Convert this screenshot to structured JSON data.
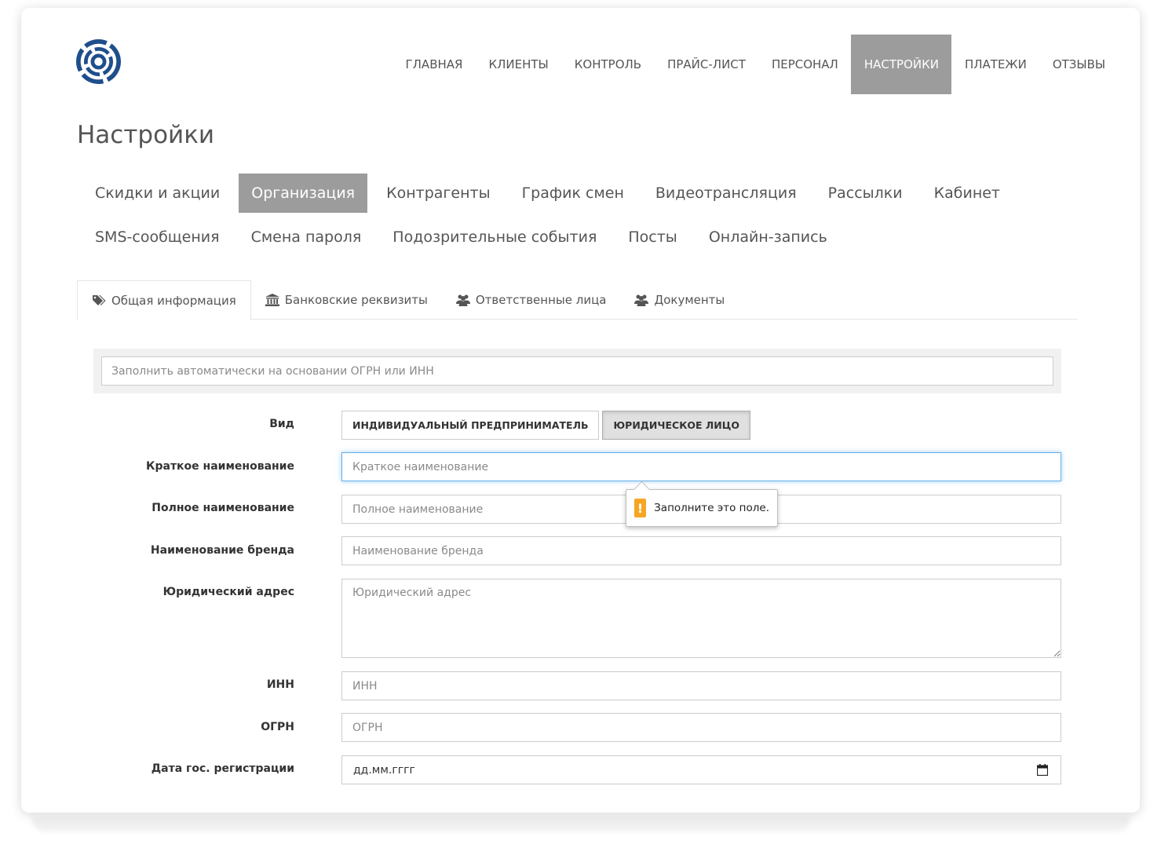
{
  "header": {
    "logo_icon": "target-logo-icon",
    "nav": [
      {
        "label": "ГЛАВНАЯ",
        "active": false
      },
      {
        "label": "КЛИЕНТЫ",
        "active": false
      },
      {
        "label": "КОНТРОЛЬ",
        "active": false
      },
      {
        "label": "ПРАЙС-ЛИСТ",
        "active": false
      },
      {
        "label": "ПЕРСОНАЛ",
        "active": false
      },
      {
        "label": "НАСТРОЙКИ",
        "active": true
      },
      {
        "label": "ПЛАТЕЖИ",
        "active": false
      },
      {
        "label": "ОТЗЫВЫ",
        "active": false
      }
    ]
  },
  "page": {
    "title": "Настройки"
  },
  "settings_tabs": {
    "row1": [
      {
        "label": "Скидки и акции",
        "active": false
      },
      {
        "label": "Организация",
        "active": true
      },
      {
        "label": "Контрагенты",
        "active": false
      },
      {
        "label": "График смен",
        "active": false
      },
      {
        "label": "Видеотрансляция",
        "active": false
      },
      {
        "label": "Рассылки",
        "active": false
      },
      {
        "label": "Кабинет",
        "active": false
      }
    ],
    "row2": [
      {
        "label": "SMS-сообщения",
        "active": false
      },
      {
        "label": "Смена пароля",
        "active": false
      },
      {
        "label": "Подозрительные события",
        "active": false
      },
      {
        "label": "Посты",
        "active": false
      },
      {
        "label": "Онлайн-запись",
        "active": false
      }
    ]
  },
  "subtabs": [
    {
      "label": "Общая информация",
      "icon": "tags-icon",
      "active": true
    },
    {
      "label": "Банковские реквизиты",
      "icon": "bank-icon",
      "active": false
    },
    {
      "label": "Ответственные лица",
      "icon": "users-icon",
      "active": false
    },
    {
      "label": "Документы",
      "icon": "users-icon",
      "active": false
    }
  ],
  "form": {
    "autofill_placeholder": "Заполнить автоматически на основании ОГРН или ИНН",
    "type_label": "Вид",
    "type_options": [
      {
        "label": "ИНДИВИДУАЛЬНЫЙ ПРЕДПРИНИМАТЕЛЬ",
        "active": false
      },
      {
        "label": "ЮРИДИЧЕСКОЕ ЛИЦО",
        "active": true
      }
    ],
    "short_name": {
      "label": "Краткое наименование",
      "placeholder": "Краткое наименование",
      "value": ""
    },
    "full_name": {
      "label": "Полное наименование",
      "placeholder": "Полное наименование",
      "value": ""
    },
    "brand_name": {
      "label": "Наименование бренда",
      "placeholder": "Наименование бренда",
      "value": ""
    },
    "legal_address": {
      "label": "Юридический адрес",
      "placeholder": "Юридический адрес",
      "value": ""
    },
    "inn": {
      "label": "ИНН",
      "placeholder": "ИНН",
      "value": ""
    },
    "ogrn": {
      "label": "ОГРН",
      "placeholder": "ОГРН",
      "value": ""
    },
    "reg_date": {
      "label": "Дата гос. регистрации",
      "value": "дд.мм.гггг",
      "icon": "calendar-icon"
    }
  },
  "validation_tooltip": {
    "icon": "warning-icon",
    "text": "Заполните это поле."
  },
  "colors": {
    "active_tab": "#9c9c9c",
    "logo": "#1f4e8c",
    "warning": "#f5a623",
    "focus": "#66afe9"
  }
}
